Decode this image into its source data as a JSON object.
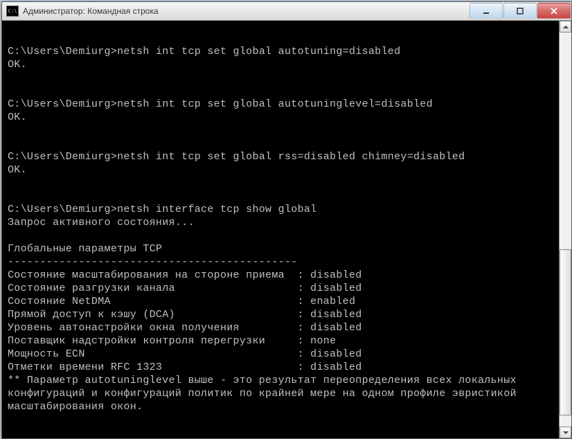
{
  "window": {
    "title": "Администратор: Командная строка"
  },
  "prompt": "C:\\Users\\Demiurg>",
  "commands": [
    {
      "cmd": "netsh int tcp set global autotuning=disabled",
      "result": "OK."
    },
    {
      "cmd": "netsh int tcp set global autotuninglevel=disabled",
      "result": "OK."
    },
    {
      "cmd": "netsh int tcp set global rss=disabled chimney=disabled",
      "result": "OK."
    },
    {
      "cmd": "netsh interface tcp show global",
      "result": null
    }
  ],
  "query_status": "Запрос активного состояния...",
  "section_header": "Глобальные параметры TCP",
  "divider": "---------------------------------------------",
  "params": [
    {
      "label": "Состояние масштабирования на стороне приема",
      "value": "disabled"
    },
    {
      "label": "Состояние разгрузки канала",
      "value": "disabled"
    },
    {
      "label": "Состояние NetDMA",
      "value": "enabled"
    },
    {
      "label": "Прямой доступ к кэшу (DCA)",
      "value": "disabled"
    },
    {
      "label": "Уровень автонастройки окна получения",
      "value": "disabled"
    },
    {
      "label": "Поставщик надстройки контроля перегрузки",
      "value": "none"
    },
    {
      "label": "Мощность ECN",
      "value": "disabled"
    },
    {
      "label": "Отметки времени RFC 1323",
      "value": "disabled"
    }
  ],
  "footer_note": "** Параметр autotuninglevel выше - это результат переопределения всех локальных\nконфигураций и конфигураций политик по крайней мере на одном профиле эвристикой\nмасштабирования окон.",
  "label_col_width": 45
}
